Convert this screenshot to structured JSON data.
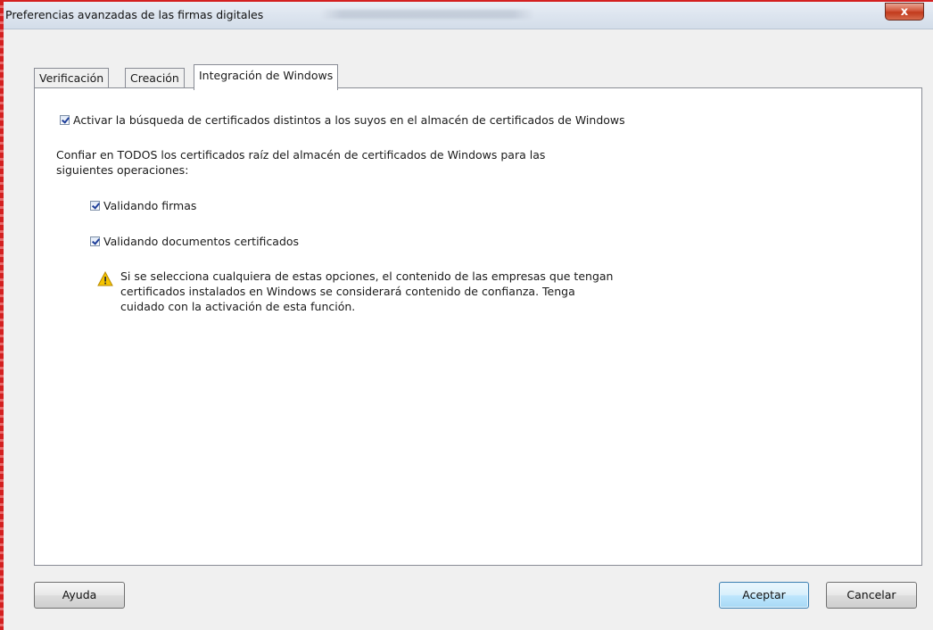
{
  "window": {
    "title": "Preferencias avanzadas de las firmas digitales",
    "close_label": "x"
  },
  "tabs": [
    {
      "label": "Verificación",
      "active": false
    },
    {
      "label": "Creación",
      "active": false
    },
    {
      "label": "Integración de Windows",
      "active": true
    }
  ],
  "panel": {
    "search_checkbox": {
      "label": "Activar la búsqueda de certificados distintos a los suyos en el almacén de certificados de Windows",
      "checked": true
    },
    "trust_text_line1": "Confiar en TODOS los certificados raíz del almacén de certificados de Windows para las",
    "trust_text_line2": "siguientes operaciones:",
    "validate_signatures": {
      "label": "Validando firmas",
      "checked": true
    },
    "validate_certified_docs": {
      "label": "Validando documentos certificados",
      "checked": true
    },
    "warning": {
      "icon": "warning-icon",
      "line1": "Si se selecciona cualquiera de estas opciones, el contenido de las empresas que tengan",
      "line2": "certificados instalados en Windows se considerará contenido de confianza. Tenga",
      "line3": "cuidado con la activación de esta función."
    }
  },
  "buttons": {
    "help": "Ayuda",
    "accept": "Aceptar",
    "cancel": "Cancelar"
  },
  "colors": {
    "frame_red": "#d42020",
    "checkmark": "#1f3f9a",
    "warning_yellow": "#f5c400"
  }
}
